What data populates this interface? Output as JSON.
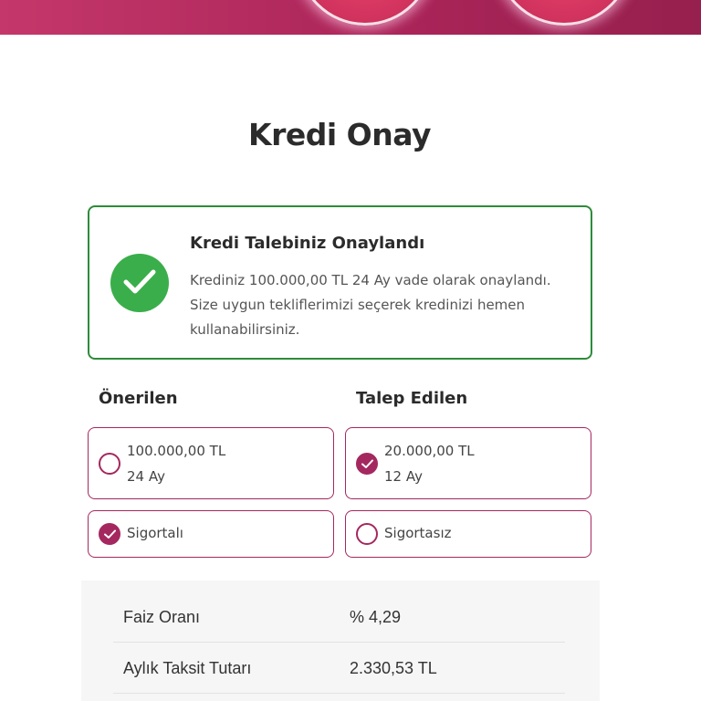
{
  "page": {
    "title": "Kredi Onay"
  },
  "approval": {
    "heading": "Kredi Talebiniz Onaylandı",
    "description": "Krediniz 100.000,00 TL 24 Ay vade olarak onaylandı. Size uygun tekliflerimizi seçerek kredinizi hemen kullanabilirsiniz.",
    "icon": "check-circle-icon"
  },
  "columns": {
    "recommended_label": "Önerilen",
    "requested_label": "Talep Edilen"
  },
  "options": {
    "recommended": {
      "amount": "100.000,00 TL",
      "term": "24 Ay",
      "selected": false
    },
    "requested": {
      "amount": "20.000,00 TL",
      "term": "12 Ay",
      "selected": true
    },
    "insured": {
      "label": "Sigortalı",
      "selected": true
    },
    "uninsured": {
      "label": "Sigortasız",
      "selected": false
    }
  },
  "details": [
    {
      "label": "Faiz Oranı",
      "value": "% 4,29"
    },
    {
      "label": "Aylık Taksit Tutarı",
      "value": "2.330,53 TL"
    }
  ],
  "colors": {
    "brand": "#a4285f",
    "success": "#3aae4a",
    "success_border": "#2e8b3a"
  }
}
